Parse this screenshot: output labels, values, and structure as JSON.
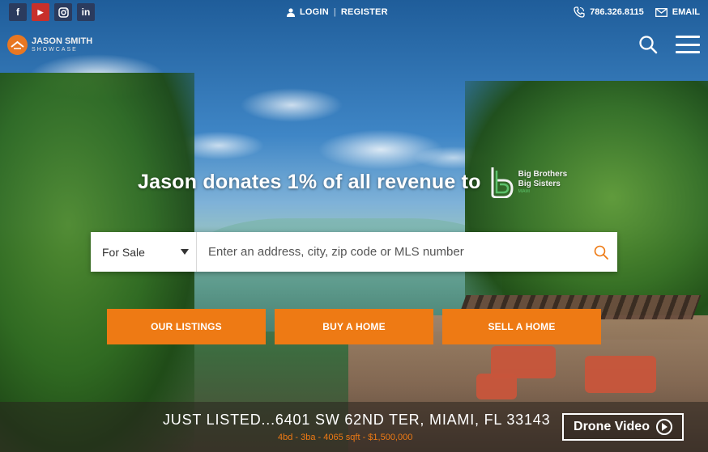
{
  "colors": {
    "accent": "#ee7a14",
    "social_bg": "#2b3b5e",
    "youtube": "#c8302b"
  },
  "social": [
    {
      "icon": "facebook-icon",
      "glyph": "f"
    },
    {
      "icon": "youtube-icon",
      "glyph": "You\nTube"
    },
    {
      "icon": "instagram-icon",
      "glyph": "◎"
    },
    {
      "icon": "linkedin-icon",
      "glyph": "in"
    }
  ],
  "auth": {
    "login": "LOGIN",
    "separator": "|",
    "register": "REGISTER"
  },
  "contact": {
    "phone": "786.326.8115",
    "email": "EMAIL"
  },
  "logo": {
    "line1": "JASON SMITH",
    "line2": "SHOWCASE"
  },
  "hero": {
    "headline": "Jason donates 1% of all revenue to",
    "charity_line1": "Big Brothers",
    "charity_line2": "Big Sisters",
    "charity_small": "MIAMI"
  },
  "search": {
    "type_selected": "For Sale",
    "placeholder": "Enter an address, city, zip code or MLS number"
  },
  "actions": {
    "listings": "OUR LISTINGS",
    "buy": "BUY A HOME",
    "sell": "SELL A HOME"
  },
  "listing": {
    "title": "JUST LISTED...6401 SW 62ND TER, MIAMI, FL 33143",
    "details": "4bd - 3ba - 4065 sqft - $1,500,000",
    "video_button": "Drone Video"
  }
}
